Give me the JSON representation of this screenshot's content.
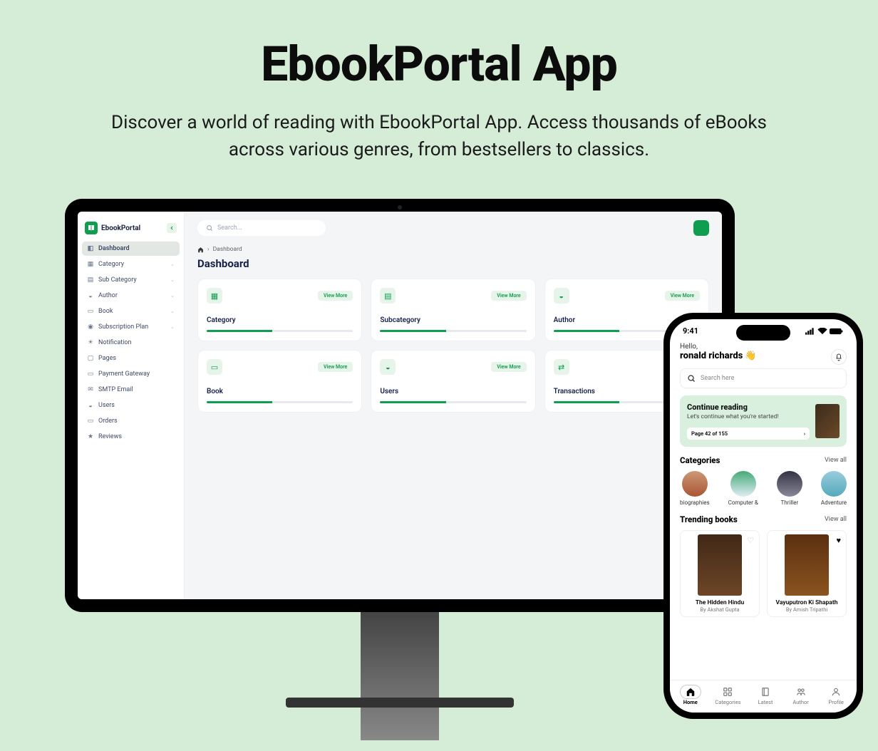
{
  "hero": {
    "title": "EbookPortal App",
    "subtitle": "Discover a world of reading with EbookPortal App. Access thousands of eBooks across various genres, from bestsellers to classics."
  },
  "dash": {
    "brand": "EbookPortal",
    "search_placeholder": "Search...",
    "crumb_home": "⌂",
    "crumb_page": "Dashboard",
    "page_title": "Dashboard",
    "view_more": "View More",
    "nav": [
      {
        "label": "Dashboard",
        "chev": false,
        "active": true
      },
      {
        "label": "Category",
        "chev": true,
        "active": false
      },
      {
        "label": "Sub Category",
        "chev": true,
        "active": false
      },
      {
        "label": "Author",
        "chev": true,
        "active": false
      },
      {
        "label": "Book",
        "chev": true,
        "active": false
      },
      {
        "label": "Subscription Plan",
        "chev": true,
        "active": false
      },
      {
        "label": "Notification",
        "chev": false,
        "active": false
      },
      {
        "label": "Pages",
        "chev": false,
        "active": false
      },
      {
        "label": "Payment Gateway",
        "chev": false,
        "active": false
      },
      {
        "label": "SMTP Email",
        "chev": false,
        "active": false
      },
      {
        "label": "Users",
        "chev": false,
        "active": false
      },
      {
        "label": "Orders",
        "chev": false,
        "active": false
      },
      {
        "label": "Reviews",
        "chev": false,
        "active": false
      }
    ],
    "cards": [
      {
        "title": "Category"
      },
      {
        "title": "Subcategory"
      },
      {
        "title": "Author"
      },
      {
        "title": "Book"
      },
      {
        "title": "Users"
      },
      {
        "title": "Transactions"
      }
    ]
  },
  "phone": {
    "time": "9:41",
    "greet": "Hello,",
    "user": "ronald richards",
    "wave": "👋",
    "search_placeholder": "Search here",
    "cont_title": "Continue reading",
    "cont_sub": "Let's continue what you're started!",
    "cont_page": "Page 42 of 155",
    "cats_title": "Categories",
    "viewall": "View all",
    "cats": [
      {
        "label": "biographies"
      },
      {
        "label": "Computer &"
      },
      {
        "label": "Thriller"
      },
      {
        "label": "Adventure"
      }
    ],
    "trend_title": "Trending books",
    "books": [
      {
        "title": "The Hidden Hindu",
        "by": "By Akshat Gupta",
        "fav": false
      },
      {
        "title": "Vayuputron Ki Shapath",
        "by": "By Amish Tripathi",
        "fav": true
      }
    ],
    "nav": [
      {
        "label": "Home",
        "on": true
      },
      {
        "label": "Categories",
        "on": false
      },
      {
        "label": "Latest",
        "on": false
      },
      {
        "label": "Author",
        "on": false
      },
      {
        "label": "Profile",
        "on": false
      }
    ]
  }
}
